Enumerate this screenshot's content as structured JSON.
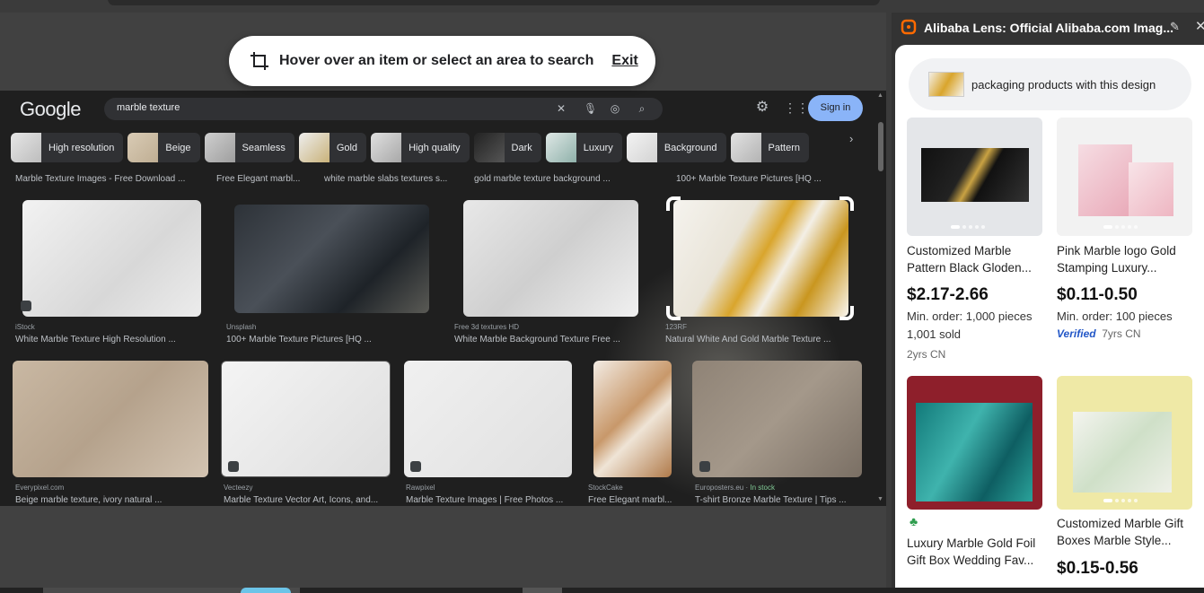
{
  "hover_bar": {
    "message": "Hover over an item or select an area to search",
    "exit": "Exit"
  },
  "google": {
    "logo": "Google",
    "query": "marble texture",
    "sign_in": "Sign in",
    "chips": [
      "High resolution",
      "Beige",
      "Seamless",
      "Gold",
      "High quality",
      "Dark",
      "Luxury",
      "Background",
      "Pattern"
    ],
    "caption_row": [
      "Marble Texture Images - Free Download ...",
      "Free Elegant marbl...",
      "white marble slabs textures s...",
      "gold marble texture background ...",
      "100+ Marble Texture Pictures [HQ ..."
    ],
    "row1": [
      {
        "source": "iStock",
        "title": "White Marble Texture High Resolution ..."
      },
      {
        "source": "Unsplash",
        "title": "100+ Marble Texture Pictures [HQ ..."
      },
      {
        "source": "Free 3d textures HD",
        "title": "White Marble Background Texture Free ..."
      },
      {
        "source": "123RF",
        "title": "Natural White And Gold Marble Texture ..."
      }
    ],
    "row2": [
      {
        "source": "Everypixel.com",
        "title": "Beige marble texture, ivory natural ..."
      },
      {
        "source": "Vecteezy",
        "title": "Marble Texture Vector Art, Icons, and..."
      },
      {
        "source": "Rawpixel",
        "title": "Marble Texture Images | Free Photos ..."
      },
      {
        "source": "StockCake",
        "title": "Free Elegant marbl..."
      },
      {
        "source": "Europosters.eu",
        "extra": "In stock",
        "title": "T-shirt Bronze Marble Texture | Tips ..."
      }
    ]
  },
  "panel": {
    "title": "Alibaba Lens: Official Alibaba.com Imag...",
    "query": "packaging products with this design",
    "products": [
      {
        "title": "Customized Marble Pattern Black Gloden...",
        "price": "$2.17-2.66",
        "min_order": "Min. order: 1,000 pieces",
        "sold": "1,001 sold",
        "meta": "2yrs  CN"
      },
      {
        "title": "Pink Marble logo Gold Stamping Luxury...",
        "price": "$0.11-0.50",
        "min_order": "Min. order: 100 pieces",
        "verified": "Verified",
        "meta": "7yrs  CN"
      },
      {
        "title": "Luxury Marble Gold Foil Gift Box Wedding Fav...",
        "price": "",
        "min_order": ""
      },
      {
        "title": "Customized Marble Gift Boxes Marble Style...",
        "price": "$0.15-0.56",
        "min_order": ""
      }
    ]
  },
  "colors": {
    "signin": "#8ab4f8",
    "verified": "#2357c7",
    "alibaba_orange": "#ff6a00"
  }
}
